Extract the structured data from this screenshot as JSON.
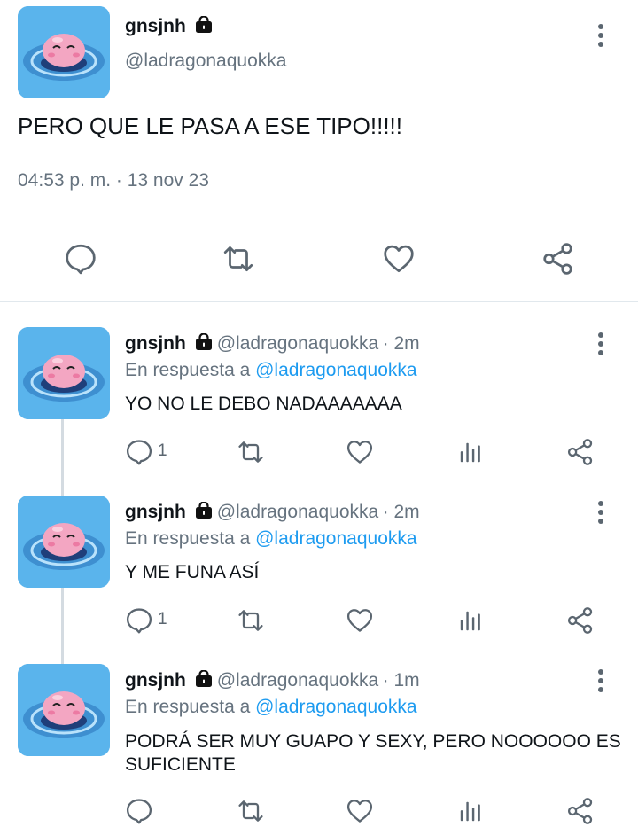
{
  "main_tweet": {
    "display_name": "gnsjnh",
    "handle": "@ladragonaquokka",
    "text": "PERO QUE LE PASA A ESE TIPO!!!!!",
    "timestamp": "04:53 p. m. · 13 nov 23",
    "actions": [
      "reply-icon",
      "retweet-icon",
      "like-icon",
      "share-icon"
    ]
  },
  "replies": [
    {
      "display_name": "gnsjnh",
      "handle": "@ladragonaquokka",
      "time": "· 2m",
      "reply_prefix": "En respuesta a",
      "reply_to": "@ladragonaquokka",
      "text": "YO NO LE DEBO NADAAAAAAA",
      "reply_count": "1"
    },
    {
      "display_name": "gnsjnh",
      "handle": "@ladragonaquokka",
      "time": "· 2m",
      "reply_prefix": "En respuesta a",
      "reply_to": "@ladragonaquokka",
      "text": "Y ME FUNA ASÍ",
      "reply_count": "1"
    },
    {
      "display_name": "gnsjnh",
      "handle": "@ladragonaquokka",
      "time": "· 1m",
      "reply_prefix": "En respuesta a",
      "reply_to": "@ladragonaquokka",
      "text_line1": "PODRÁ SER MUY GUAPO Y SEXY, PERO NOOOOOO ES",
      "text_line2": "SUFICIENTE",
      "reply_count": ""
    }
  ],
  "colors": {
    "accent": "#1d9bf0",
    "icon": "#5b6670",
    "text": "#0f1419",
    "muted": "#66737f",
    "avatar_bg": "#5ab4ec"
  }
}
